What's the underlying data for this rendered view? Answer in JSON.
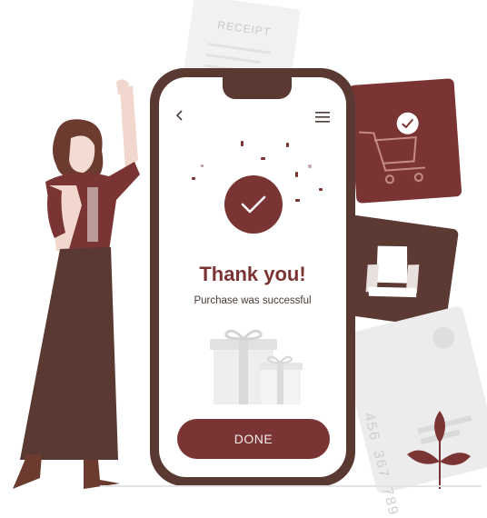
{
  "receipt": {
    "title": "RECEIPT"
  },
  "credit_card": {
    "number": "456 367 789"
  },
  "screen": {
    "title": "Thank you!",
    "subtitle": "Purchase was successful",
    "done_label": "DONE"
  },
  "icons": {
    "back": "chevron-left-icon",
    "menu": "hamburger-menu-icon",
    "check": "check-icon",
    "cart": "shopping-cart-icon",
    "chair": "armchair-icon",
    "gift": "gift-icon"
  },
  "colors": {
    "accent": "#7b3434",
    "phone_frame": "#5a3932",
    "muted": "#ececec"
  }
}
